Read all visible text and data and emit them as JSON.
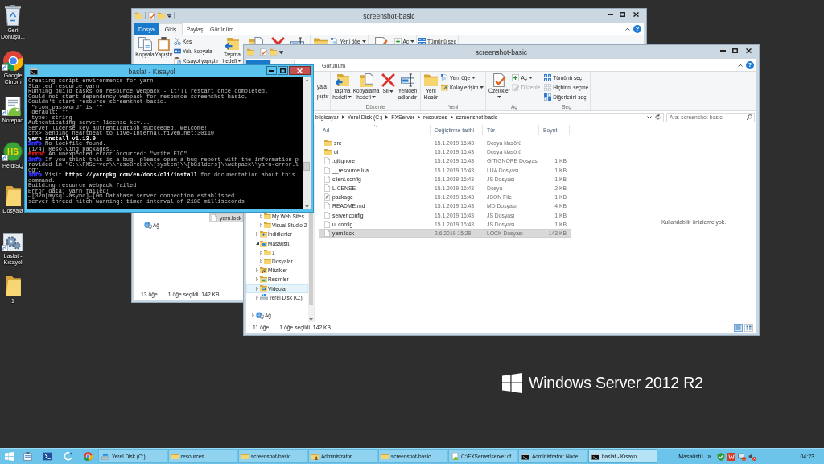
{
  "desktop": {
    "icons": [
      {
        "label": "Geri Dönüşü...",
        "kind": "bin",
        "shortcut": false
      },
      {
        "label": "Google Chrom",
        "kind": "browser",
        "shortcut": true
      },
      {
        "label": "Notepad",
        "kind": "editor",
        "shortcut": true
      },
      {
        "label": "HeidiSQ",
        "kind": "database",
        "shortcut": true,
        "logo_text": "HS"
      },
      {
        "label": "Dosyala",
        "kind": "folder",
        "shortcut": false
      },
      {
        "label": "baslat - Kısayol",
        "kind": "gears",
        "shortcut": true
      },
      {
        "label": "1",
        "kind": "folder",
        "shortcut": false
      }
    ],
    "wallpaper_logo": "Windows Server 2012 R2"
  },
  "back_explorer": {
    "title": "screenshot-basic",
    "active": false,
    "tabs": [
      {
        "kind": "file",
        "label": "Dosya"
      },
      {
        "kind": "tab",
        "label": "Giriş",
        "selected": true
      },
      {
        "kind": "tab",
        "label": "Paylaş",
        "selected": false
      },
      {
        "kind": "tab",
        "label": "Görünüm",
        "selected": false
      }
    ],
    "help": "?",
    "ribbon": {
      "groups": [
        {
          "large": [
            {
              "kind": "copy",
              "label": "Kopyala",
              "dropdown": false
            },
            {
              "kind": "paste",
              "label": "Yapıştır",
              "dropdown": false
            }
          ],
          "small": [
            {
              "kind": "cut",
              "label": "Kes",
              "dropdown": false,
              "disabled": false
            },
            {
              "kind": "path",
              "label": "Yolu kopyala",
              "dropdown": false,
              "disabled": false
            },
            {
              "kind": "shortcut",
              "label": "Kısayol yapıştır",
              "dropdown": false,
              "disabled": false
            }
          ]
        },
        {
          "large": [
            {
              "kind": "moveto",
              "label": "Taşıma hedefi",
              "dropdown": true
            },
            {
              "kind": "copyto"
            },
            {
              "kind": "delete"
            },
            {
              "kind": "rename"
            }
          ]
        },
        {
          "large": [
            {
              "kind": "newfolder"
            }
          ],
          "small": [
            {
              "kind": "newitem",
              "label": "Yeni öğe",
              "dropdown": true,
              "disabled": false
            }
          ]
        },
        {
          "large": [
            {
              "kind": "properties"
            }
          ],
          "small": [
            {
              "kind": "open",
              "label": "Aç",
              "dropdown": true,
              "disabled": false
            }
          ]
        },
        {
          "small": [
            {
              "kind": "selectall",
              "label": "Tümünü seç",
              "dropdown": false,
              "disabled": false
            }
          ]
        }
      ]
    },
    "nav_pane": {
      "tree": [
        {
          "label": "Ağ",
          "kind": "network"
        }
      ]
    },
    "files": [
      {
        "name": "yarn.lock",
        "kind": "file",
        "selected": true
      }
    ],
    "status": {
      "count": "13 öğe",
      "selection": "1 öğe seçildi  142 KB"
    }
  },
  "front_explorer": {
    "title": "screenshot-basic",
    "active": false,
    "tabs": [
      {
        "kind": "file"
      },
      {
        "kind": "tab",
        "selected": true
      },
      {
        "kind": "tab",
        "selected": false
      },
      {
        "kind": "tab",
        "label": "Görünüm",
        "selected": false
      }
    ],
    "help": "?",
    "ribbon": {
      "clipped_labels": [
        "yala",
        "pıştır"
      ],
      "groups": [
        {
          "label": "Düzenle",
          "large": [
            {
              "kind": "moveto",
              "label": "Taşıma hedefi",
              "dropdown": true
            },
            {
              "kind": "copyto",
              "label": "Kopyalama hedefi",
              "dropdown": true
            },
            {
              "kind": "delete",
              "label": "Sil",
              "dropdown": true
            },
            {
              "kind": "rename",
              "label": "Yeniden adlandır",
              "dropdown": false
            }
          ]
        },
        {
          "label": "Yeni",
          "large": [
            {
              "kind": "newfolder",
              "label": "Yeni klasör",
              "dropdown": false
            }
          ],
          "small": [
            {
              "kind": "newitem",
              "label": "Yeni öğe",
              "dropdown": true,
              "disabled": false
            },
            {
              "kind": "easyaccess",
              "label": "Kolay erişim",
              "dropdown": true,
              "disabled": false
            }
          ]
        },
        {
          "label": "Aç",
          "large": [
            {
              "kind": "properties",
              "label": "Özellikler",
              "dropdown": true
            }
          ],
          "small": [
            {
              "kind": "open",
              "label": "Aç",
              "dropdown": true,
              "disabled": false
            },
            {
              "kind": "edit",
              "label": "Düzenle",
              "dropdown": false,
              "disabled": true
            }
          ]
        },
        {
          "label": "Seç",
          "small": [
            {
              "kind": "selectall",
              "label": "Tümünü seç",
              "dropdown": false,
              "disabled": false
            },
            {
              "kind": "selectnone",
              "label": "Hiçbirini seçme",
              "dropdown": false,
              "disabled": false
            },
            {
              "kind": "invert",
              "label": "Diğerlerini seç",
              "dropdown": false,
              "disabled": false
            }
          ]
        }
      ]
    },
    "address": {
      "breadcrumb": [
        "bilgisayar",
        "Yerel Disk (C:)",
        "FXServer",
        "resources",
        "screenshot-basic"
      ]
    },
    "search": {
      "placeholder": "Ara: screenshot-basic"
    },
    "nav_pane": {
      "tree": [
        {
          "children": [
            {
              "children": [
                {
                  "label": "My Web Sites",
                  "kind": "folder",
                  "expanded": false,
                  "hovered": false
                },
                {
                  "label": "Visual Studio 2",
                  "kind": "folder",
                  "expanded": false,
                  "hovered": false
                }
              ]
            },
            {
              "label": "İndirilenler",
              "kind": "downloads",
              "expanded": false,
              "hovered": false
            },
            {
              "label": "Masaüstü",
              "kind": "desktop",
              "expanded": true,
              "hovered": false,
              "children": [
                {
                  "label": "1",
                  "kind": "folder",
                  "expanded": false,
                  "hovered": false
                },
                {
                  "label": "Dosyalar",
                  "kind": "folder",
                  "expanded": false,
                  "hovered": false
                }
              ]
            },
            {
              "label": "Müzikler",
              "kind": "music",
              "expanded": false,
              "hovered": false
            },
            {
              "label": "Resimler",
              "kind": "pictures",
              "expanded": false,
              "hovered": false
            },
            {
              "label": "Videolar",
              "kind": "videos",
              "expanded": false,
              "hovered": true
            },
            {
              "label": "Yerel Disk (C:)",
              "kind": "drive",
              "expanded": false,
              "hovered": false
            }
          ]
        },
        {
          "label": "Ağ",
          "kind": "network",
          "expanded": false,
          "hovered": false
        }
      ]
    },
    "columns": [
      {
        "label": "Ad",
        "sorted": true
      },
      {
        "label": "Değiştirme tarihi",
        "sorted": false
      },
      {
        "label": "Tür",
        "sorted": false
      },
      {
        "label": "Boyut",
        "sorted": false
      }
    ],
    "files": [
      {
        "name": "src",
        "kind": "folder",
        "date": "15.1.2019 16:43",
        "type": "Dosya klasörü",
        "selected": false
      },
      {
        "name": "ui",
        "kind": "folder",
        "date": "15.1.2019 16:43",
        "type": "Dosya klasörü",
        "selected": false
      },
      {
        "name": ".gitignore",
        "kind": "file",
        "date": "15.1.2019 16:43",
        "type": "GITIGNORE Dosyası",
        "size": "1 KB",
        "selected": false
      },
      {
        "name": "__resource.lua",
        "kind": "file",
        "date": "15.1.2019 16:43",
        "type": "LUA Dosyası",
        "size": "1 KB",
        "selected": false
      },
      {
        "name": "client.config",
        "kind": "file",
        "date": "15.1.2019 16:43",
        "type": "JS Dosyası",
        "size": "1 KB",
        "selected": false
      },
      {
        "name": "LICENSE",
        "kind": "file",
        "date": "15.1.2019 16:43",
        "type": "Dosya",
        "size": "2 KB",
        "selected": false
      },
      {
        "name": "package",
        "kind": "json",
        "date": "15.1.2019 16:43",
        "type": "JSON File",
        "size": "1 KB",
        "selected": false
      },
      {
        "name": "README.md",
        "kind": "file",
        "date": "15.1.2019 16:43",
        "type": "MD Dosyası",
        "size": "4 KB",
        "selected": false
      },
      {
        "name": "server.config",
        "kind": "file",
        "date": "15.1.2019 16:43",
        "type": "JS Dosyası",
        "size": "1 KB",
        "selected": false
      },
      {
        "name": "ui.config",
        "kind": "file",
        "date": "15.1.2019 16:43",
        "type": "JS Dosyası",
        "size": "1 KB",
        "selected": false
      },
      {
        "name": "yarn.lock",
        "kind": "file",
        "date": "2.6.2019 15:28",
        "type": "LOCK Dosyası",
        "size": "143 KB",
        "selected": true
      }
    ],
    "preview": "Kullanılabilir önizleme yok.",
    "status": {
      "count": "11 öğe",
      "selection": "1 öğe seçildi  142 KB",
      "views": [
        {
          "kind": "details",
          "selected": true
        },
        {
          "kind": "thumbnails",
          "selected": false
        }
      ]
    }
  },
  "console": {
    "title": "baslat - Kısayol",
    "active": true,
    "lines": [
      {
        "kind": "plain",
        "text": "Creating script environments for yarn"
      },
      {
        "kind": "plain",
        "text": "Started resource yarn"
      },
      {
        "kind": "plain",
        "text": "Running build tasks on resource webpack - it'll restart once completed."
      },
      {
        "kind": "plain",
        "text": "Could not start dependency webpack for resource screenshot-basic."
      },
      {
        "kind": "plain",
        "text": "Couldn't start resource screenshot-basic."
      },
      {
        "kind": "plain",
        "text": " \"rcon_password\" is \"\""
      },
      {
        "kind": "plain",
        "text": " default: \"\""
      },
      {
        "kind": "plain",
        "text": " type: string"
      },
      {
        "kind": "plain",
        "text": "Authenticating server license key..."
      },
      {
        "kind": "plain",
        "text": "Server license key authentication succeeded. Welcome!"
      },
      {
        "kind": "plain",
        "text": "cfx> Sending heartbeat to live-internal.fivem.net:30110"
      },
      {
        "kind": "bold",
        "text": "yarn install v1.13.0"
      },
      {
        "kind": "tagged",
        "tag": "info",
        "color": "#3434ff",
        "text": " No lockfile found."
      },
      {
        "kind": "plain",
        "text": "[1/4] Resolving packages..."
      },
      {
        "kind": "tagged",
        "tag": "error",
        "color": "#d01818",
        "text": " An unexpected error occurred: \"write EIO\"."
      },
      {
        "kind": "tagged",
        "tag": "info",
        "color": "#3434ff",
        "text": " If you think this is a bug, please open a bug report with the information p"
      },
      {
        "kind": "plain",
        "text": "rovided in \"C:\\\\FXServer\\\\resources\\\\[system]\\\\[builders]\\\\webpack\\\\yarn-error.l"
      },
      {
        "kind": "plain",
        "text": "og\"."
      },
      {
        "kind": "tagged",
        "tag": "info",
        "color": "#3434ff",
        "text": " Visit **https://yarnpkg.com/en/docs/cli/install** for documentation about this"
      },
      {
        "kind": "plain",
        "text": "command."
      },
      {
        "kind": "plain",
        "text": "Building resource webpack failed."
      },
      {
        "kind": "plain",
        "text": "Error data: yarn failed!"
      },
      {
        "kind": "plain",
        "text": "←[32m[mysql-async]←[0m Database server connection established."
      },
      {
        "kind": "plain",
        "text": "server thread hitch warning: timer interval of 2188 milliseconds"
      }
    ]
  },
  "taskbar": {
    "tasks": [
      {
        "label": "Yerel Disk (C:)",
        "kind": "drive",
        "selected": false
      },
      {
        "label": "resources",
        "kind": "explorer",
        "selected": false
      },
      {
        "label": "screenshot-basic",
        "kind": "explorer",
        "selected": false
      },
      {
        "label": "Administrator",
        "kind": "userfolder",
        "selected": false
      },
      {
        "label": "screenshot-basic",
        "kind": "explorer",
        "selected": false
      },
      {
        "label": "C:\\FXServer\\server.cf...",
        "kind": "notepad",
        "selected": false
      },
      {
        "label": "Administrator: Node....",
        "kind": "console",
        "selected": false
      },
      {
        "label": "baslat - Kısayol",
        "kind": "console",
        "selected": true
      }
    ],
    "toolbar_label": "Masaüstü",
    "toolbar_overflow": "»",
    "clock": "04:23"
  }
}
